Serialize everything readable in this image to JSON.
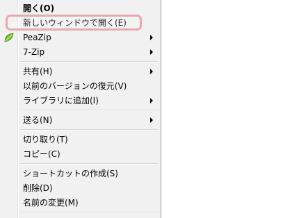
{
  "context_menu": {
    "items": [
      {
        "label": "開く(O)",
        "bold": true,
        "submenu": false
      },
      {
        "label": "新しいウィンドウで開く(E)",
        "bold": false,
        "submenu": false,
        "highlighted": true
      },
      {
        "label": "PeaZip",
        "bold": false,
        "submenu": true,
        "icon": "peazip-leaf-icon"
      },
      {
        "label": "7-Zip",
        "bold": false,
        "submenu": true
      },
      {
        "label": "共有(H)",
        "bold": false,
        "submenu": true
      },
      {
        "label": "以前のバージョンの復元(V)",
        "bold": false,
        "submenu": false
      },
      {
        "label": "ライブラリに追加(I)",
        "bold": false,
        "submenu": true
      },
      {
        "label": "送る(N)",
        "bold": false,
        "submenu": true
      },
      {
        "label": "切り取り(T)",
        "bold": false,
        "submenu": false
      },
      {
        "label": "コピー(C)",
        "bold": false,
        "submenu": false
      },
      {
        "label": "ショートカットの作成(S)",
        "bold": false,
        "submenu": false
      },
      {
        "label": "削除(D)",
        "bold": false,
        "submenu": false
      },
      {
        "label": "名前の変更(M)",
        "bold": false,
        "submenu": false
      }
    ]
  },
  "colors": {
    "menu_background": "#f1f1f1",
    "highlight_border": "#e8a8b4",
    "peazip_icon": "#6fbf2a"
  }
}
